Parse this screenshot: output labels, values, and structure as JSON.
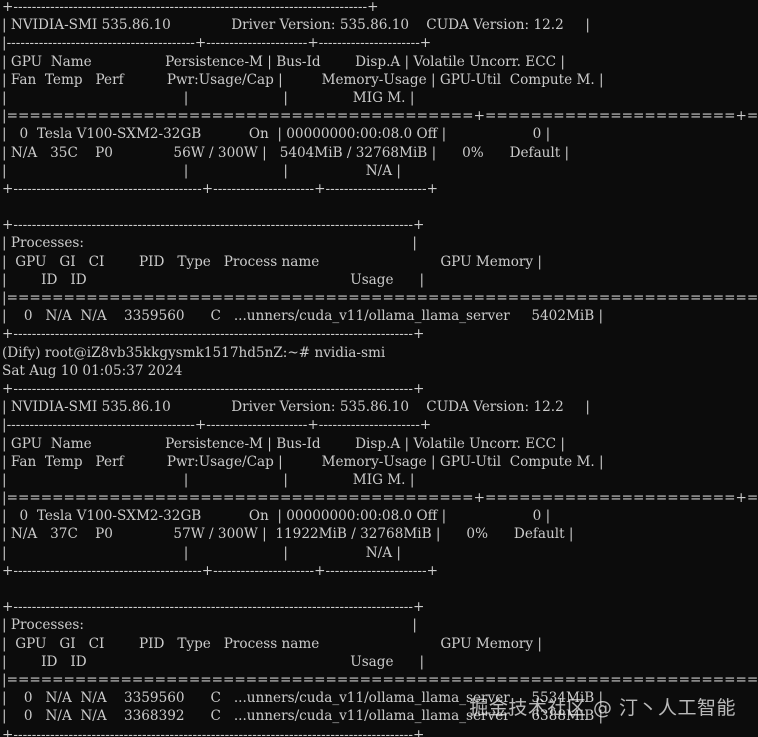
{
  "terminal": {
    "background": "#0c0c0c",
    "foreground": "#cccccc",
    "lines": [
      "+-----------------------------------------------------------------------------+",
      "| NVIDIA-SMI 535.86.10              Driver Version: 535.86.10    CUDA Version: 12.2     |",
      "|-----------------------------------------+----------------------+----------------------+",
      "| GPU  Name                 Persistence-M | Bus-Id        Disp.A | Volatile Uncorr. ECC |",
      "| Fan  Temp   Perf          Pwr:Usage/Cap |         Memory-Usage | GPU-Util  Compute M. |",
      "|                                         |                      |               MIG M. |",
      "|=========================================+======================+======================|",
      "|   0  Tesla V100-SXM2-32GB           On  | 00000000:00:08.0 Off |                    0 |",
      "| N/A   35C    P0              56W / 300W |   5404MiB / 32768MiB |      0%      Default |",
      "|                                         |                      |                  N/A |",
      "+-----------------------------------------+----------------------+----------------------+",
      "",
      "+---------------------------------------------------------------------------------------+",
      "| Processes:                                                                            |",
      "|  GPU   GI   CI        PID   Type   Process name                            GPU Memory |",
      "|        ID   ID                                                             Usage      |",
      "|=======================================================================================|",
      "|    0   N/A  N/A    3359560      C   ...unners/cuda_v11/ollama_llama_server     5402MiB |",
      "+---------------------------------------------------------------------------------------+",
      "(Dify) root@iZ8vb35kkgysmk1517hd5nZ:~# nvidia-smi",
      "Sat Aug 10 01:05:37 2024",
      "+---------------------------------------------------------------------------------------+",
      "| NVIDIA-SMI 535.86.10              Driver Version: 535.86.10    CUDA Version: 12.2     |",
      "|-----------------------------------------+----------------------+----------------------+",
      "| GPU  Name                 Persistence-M | Bus-Id        Disp.A | Volatile Uncorr. ECC |",
      "| Fan  Temp   Perf          Pwr:Usage/Cap |         Memory-Usage | GPU-Util  Compute M. |",
      "|                                         |                      |               MIG M. |",
      "|=========================================+======================+======================|",
      "|   0  Tesla V100-SXM2-32GB           On  | 00000000:00:08.0 Off |                    0 |",
      "| N/A   37C    P0              57W / 300W |  11922MiB / 32768MiB |      0%      Default |",
      "|                                         |                      |                  N/A |",
      "+-----------------------------------------+----------------------+----------------------+",
      "",
      "+---------------------------------------------------------------------------------------+",
      "| Processes:                                                                            |",
      "|  GPU   GI   CI        PID   Type   Process name                            GPU Memory |",
      "|        ID   ID                                                             Usage      |",
      "|=======================================================================================|",
      "|    0   N/A  N/A    3359560      C   ...unners/cuda_v11/ollama_llama_server     5534MiB |",
      "|    0   N/A  N/A    3368392      C   ...unners/cuda_v11/ollama_llama_server     6388MiB |",
      "+---------------------------------------------------------------------------------------+"
    ]
  },
  "watermark": {
    "text": "掘金技术社区 @ 汀丶人工智能"
  }
}
